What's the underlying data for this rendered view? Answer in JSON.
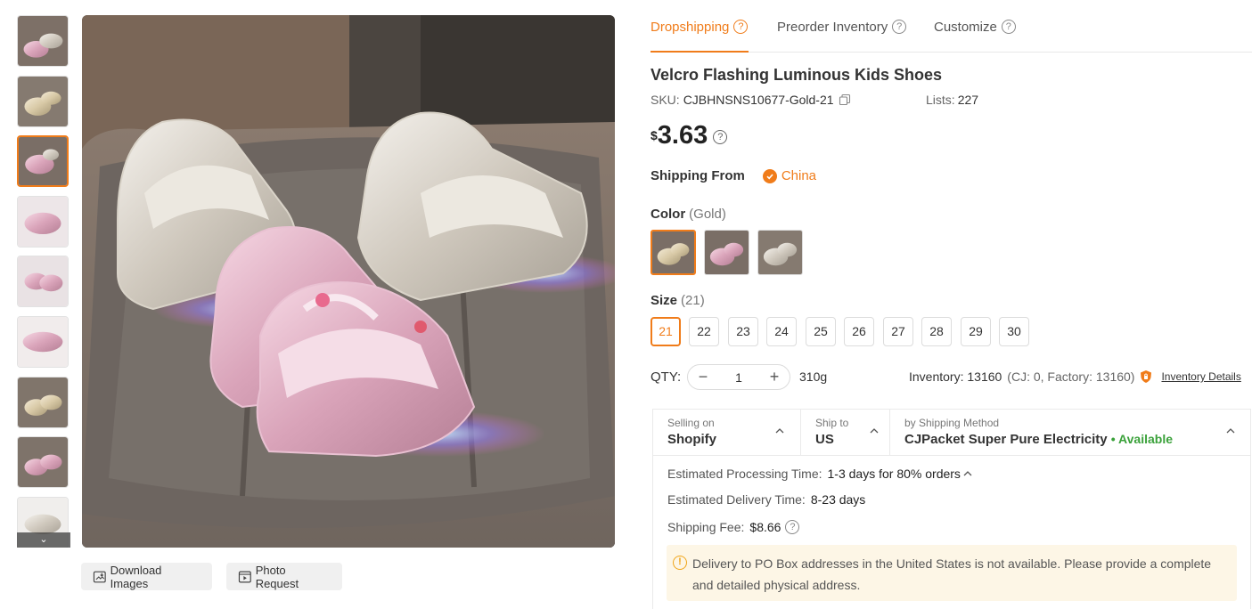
{
  "gallery": {
    "thumbnails": [
      {
        "variant": "pink-gold-mix"
      },
      {
        "variant": "gold"
      },
      {
        "variant": "pink-active"
      },
      {
        "variant": "pink-closeup"
      },
      {
        "variant": "pink-pair"
      },
      {
        "variant": "pink-detail"
      },
      {
        "variant": "gold-pair"
      },
      {
        "variant": "pink-pair-2"
      },
      {
        "variant": "silver"
      }
    ],
    "more_icon": "chevron-down-icon",
    "download_label": "Download Images",
    "photo_request_label": "Photo Request"
  },
  "tabs": [
    {
      "label": "Dropshipping",
      "active": true
    },
    {
      "label": "Preorder Inventory",
      "active": false
    },
    {
      "label": "Customize",
      "active": false
    }
  ],
  "product": {
    "title": "Velcro Flashing Luminous Kids Shoes",
    "sku_label": "SKU:",
    "sku": "CJBHNSNS10677-Gold-21",
    "lists_label": "Lists:",
    "lists": "227",
    "currency": "$",
    "price": "3.63",
    "shipping_from_label": "Shipping From",
    "shipping_from": "China",
    "color_label": "Color",
    "color_selected": "(Gold)",
    "colors": [
      "Gold",
      "Pink",
      "Silver"
    ],
    "size_label": "Size",
    "size_selected": "(21)",
    "sizes": [
      "21",
      "22",
      "23",
      "24",
      "25",
      "26",
      "27",
      "28",
      "29",
      "30"
    ],
    "qty_label": "QTY:",
    "qty": "1",
    "weight": "310g",
    "inventory": "Inventory: 13160",
    "inventory_detail": "(CJ: 0, Factory: 13160)",
    "inventory_link": "Inventory Details"
  },
  "shipping": {
    "selling_on_label": "Selling on",
    "selling_on": "Shopify",
    "ship_to_label": "Ship to",
    "ship_to": "US",
    "method_label": "by Shipping Method",
    "method": "CJPacket Super Pure Electricity",
    "availability": "• Available",
    "processing_label": "Estimated Processing Time:",
    "processing": "1-3 days for 80% orders",
    "delivery_label": "Estimated Delivery Time:",
    "delivery": "8-23 days",
    "fee_label": "Shipping Fee:",
    "fee": "$8.66",
    "notice": "Delivery to PO Box addresses in the United States is not available. Please provide a complete and detailed physical address."
  },
  "colors": {
    "accent": "#f07c1a",
    "available": "#3aa13a",
    "notice_bg": "#fdf6e6"
  }
}
